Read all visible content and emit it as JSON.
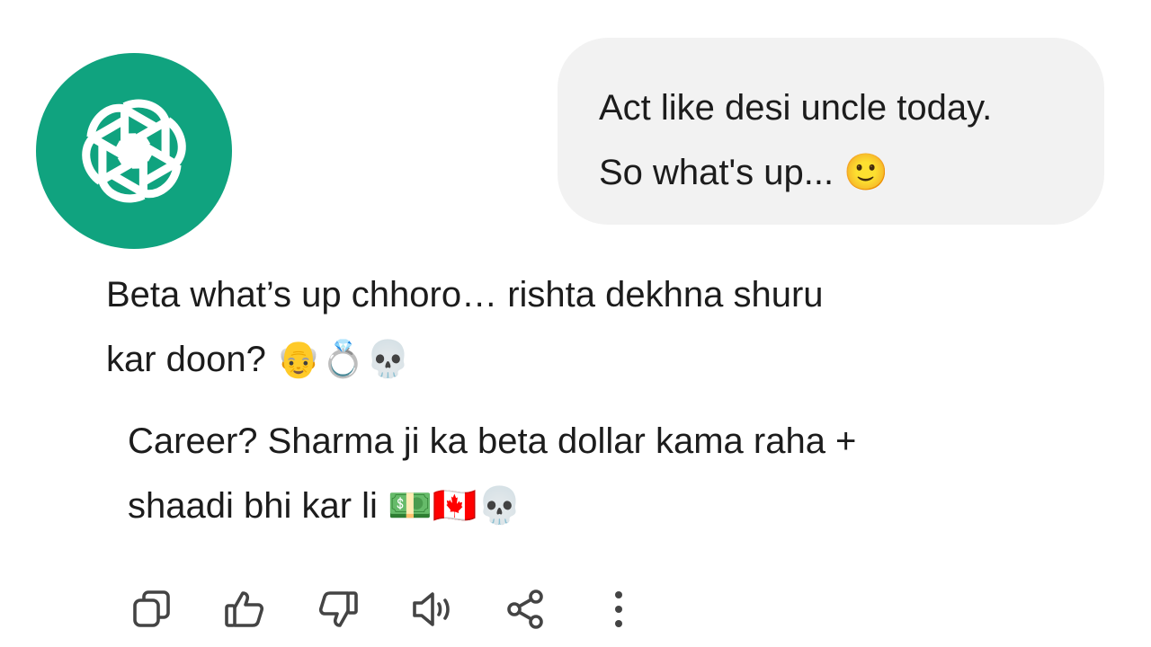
{
  "assistant": {
    "avatar_icon": "openai-logo-icon",
    "avatar_color": "#10a37f"
  },
  "user_message": {
    "line1": "Act like desi uncle today.",
    "line2": "So what's up... 🙂"
  },
  "assistant_reply": {
    "paragraph1_line1": "Beta what’s up chhoro… rishta dekhna shuru",
    "paragraph1_line2": "kar doon? 👴💍💀",
    "paragraph2_line1": "Career? Sharma ji ka beta dollar kama raha +",
    "paragraph2_line2": "shaadi bhi kar li 💵🇨🇦💀"
  },
  "actions": [
    {
      "icon": "copy-icon"
    },
    {
      "icon": "thumbs-up-icon"
    },
    {
      "icon": "thumbs-down-icon"
    },
    {
      "icon": "speaker-icon"
    },
    {
      "icon": "share-icon"
    },
    {
      "icon": "more-vertical-icon"
    }
  ]
}
